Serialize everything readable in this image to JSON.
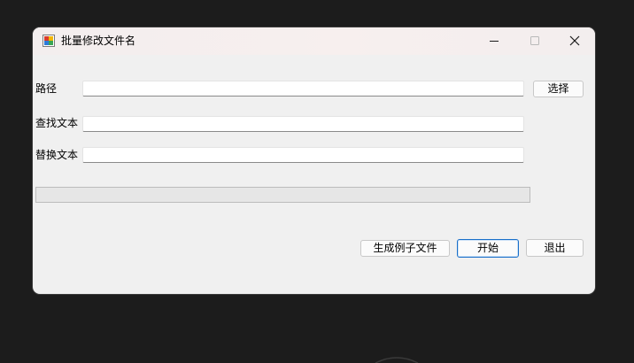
{
  "window": {
    "title": "批量修改文件名",
    "icon": "app-icon",
    "caption_buttons": [
      "minimize-icon",
      "maximize-icon",
      "close-icon"
    ]
  },
  "form": {
    "path_label": "路径",
    "path_value": "",
    "find_label": "查找文本",
    "find_value": "",
    "replace_label": "替换文本",
    "replace_value": ""
  },
  "buttons": {
    "browse": "选择",
    "generate_sample": "生成例子文件",
    "start": "开始",
    "exit": "退出"
  },
  "progress": {
    "value": 0
  },
  "colors": {
    "window_bg": "#f0f0f0",
    "desktop_bg": "#1c1c1c",
    "default_button_border": "#1a6fc9",
    "progress_fill": "#06b025"
  }
}
